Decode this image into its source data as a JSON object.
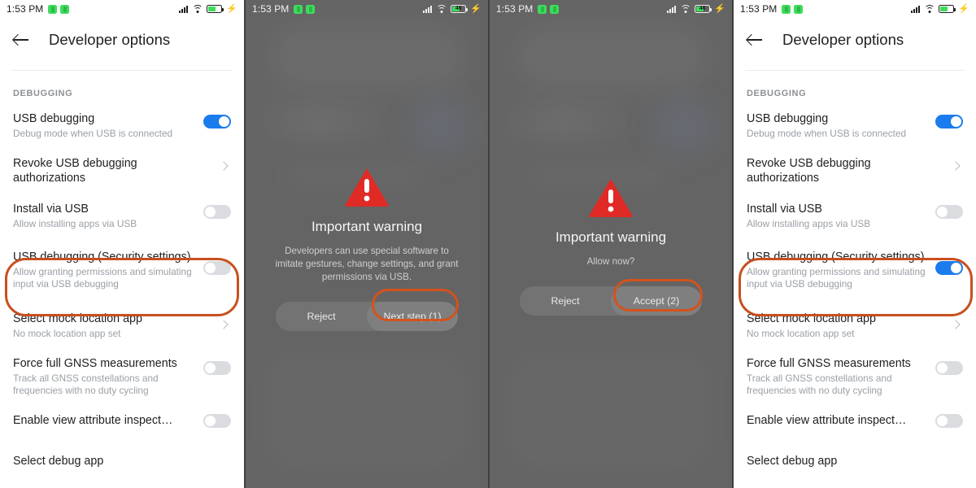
{
  "status_bar": {
    "time": "1:53 PM",
    "left_icons": [
      "app-badge-icon",
      "app-badge-icon"
    ],
    "right_icons": [
      "signal-bars-icon",
      "wifi-icon",
      "battery-icon",
      "charging-bolt-icon"
    ],
    "battery_level": "46",
    "bolt_glyph": "⚡"
  },
  "app": {
    "title": "Developer options",
    "back_icon": "back-arrow-icon",
    "section_label": "DEBUGGING"
  },
  "colors": {
    "accent_blue": "#1b7ced",
    "highlight_orange": "#c8501e",
    "warning_red": "#e02a26",
    "battery_green": "#3ddc5b",
    "toggle_off": "#dadce0",
    "dim_backdrop": "#646464"
  },
  "settings_rows": [
    {
      "title": "USB debugging",
      "subtitle": "Debug mode when USB is connected",
      "control": "toggle",
      "state_before": "on",
      "state_after": "on"
    },
    {
      "title": "Revoke USB debugging authorizations",
      "subtitle": "",
      "control": "chevron",
      "state_before": "",
      "state_after": ""
    },
    {
      "title": "Install via USB",
      "subtitle": "Allow installing apps via USB",
      "control": "toggle",
      "state_before": "off",
      "state_after": "off"
    },
    {
      "title": "USB debugging (Security settings)",
      "subtitle": "Allow granting permissions and simulating input via USB debugging",
      "control": "toggle",
      "state_before": "off",
      "state_after": "on",
      "highlighted": true
    },
    {
      "title": "Select mock location app",
      "subtitle": "No mock location app set",
      "control": "chevron",
      "state_before": "",
      "state_after": ""
    },
    {
      "title": "Force full GNSS measurements",
      "subtitle": "Track all GNSS constellations and frequencies with no duty cycling",
      "control": "toggle",
      "state_before": "off",
      "state_after": "off"
    },
    {
      "title": "Enable view attribute inspect…",
      "subtitle": "",
      "control": "toggle",
      "state_before": "off",
      "state_after": "off"
    },
    {
      "title": "Select debug app",
      "subtitle": "",
      "control": "none",
      "state_before": "",
      "state_after": ""
    }
  ],
  "dialog_step1": {
    "icon": "warning-triangle-icon",
    "title": "Important warning",
    "body": "Developers can use special software to imitate gestures, change settings, and grant permissions via USB.",
    "reject_label": "Reject",
    "confirm_label": "Next step (1)",
    "confirm_highlighted": true
  },
  "dialog_step2": {
    "icon": "warning-triangle-icon",
    "title": "Important warning",
    "body": "Allow now?",
    "reject_label": "Reject",
    "confirm_label": "Accept (2)",
    "confirm_highlighted": true
  }
}
